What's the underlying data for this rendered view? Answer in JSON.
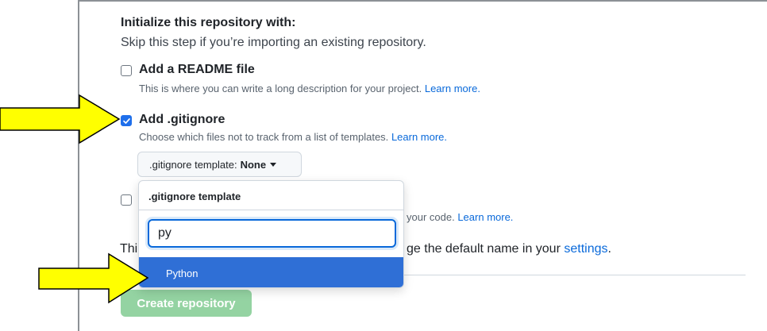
{
  "section": {
    "heading": "Initialize this repository with:",
    "subtext": "Skip this step if you’re importing an existing repository."
  },
  "readme": {
    "title": "Add a README file",
    "desc": "This is where you can write a long description for your project.",
    "link": "Learn more.",
    "checked": false
  },
  "gitignore": {
    "title": "Add .gitignore",
    "desc": "Choose which files not to track from a list of templates.",
    "link": "Learn more.",
    "checked": true,
    "button_prefix": ".gitignore template:",
    "button_value": "None"
  },
  "license": {
    "desc_visible": "your code.",
    "link": "Learn more.",
    "checked": false
  },
  "branch_note": {
    "prefix_visible": "Thi",
    "suffix_visible": "ge the default name in your",
    "link": "settings",
    "end": "."
  },
  "dropdown": {
    "header": ".gitignore template",
    "filter_value": "py",
    "items": [
      {
        "label": "Python",
        "selected": true
      }
    ]
  },
  "create_button": "Create repository",
  "colors": {
    "accent": "#0969da",
    "selected_item": "#2f6fd6",
    "create_button_disabled": "#94d3a2",
    "annotation_arrow": "#ffff00"
  }
}
